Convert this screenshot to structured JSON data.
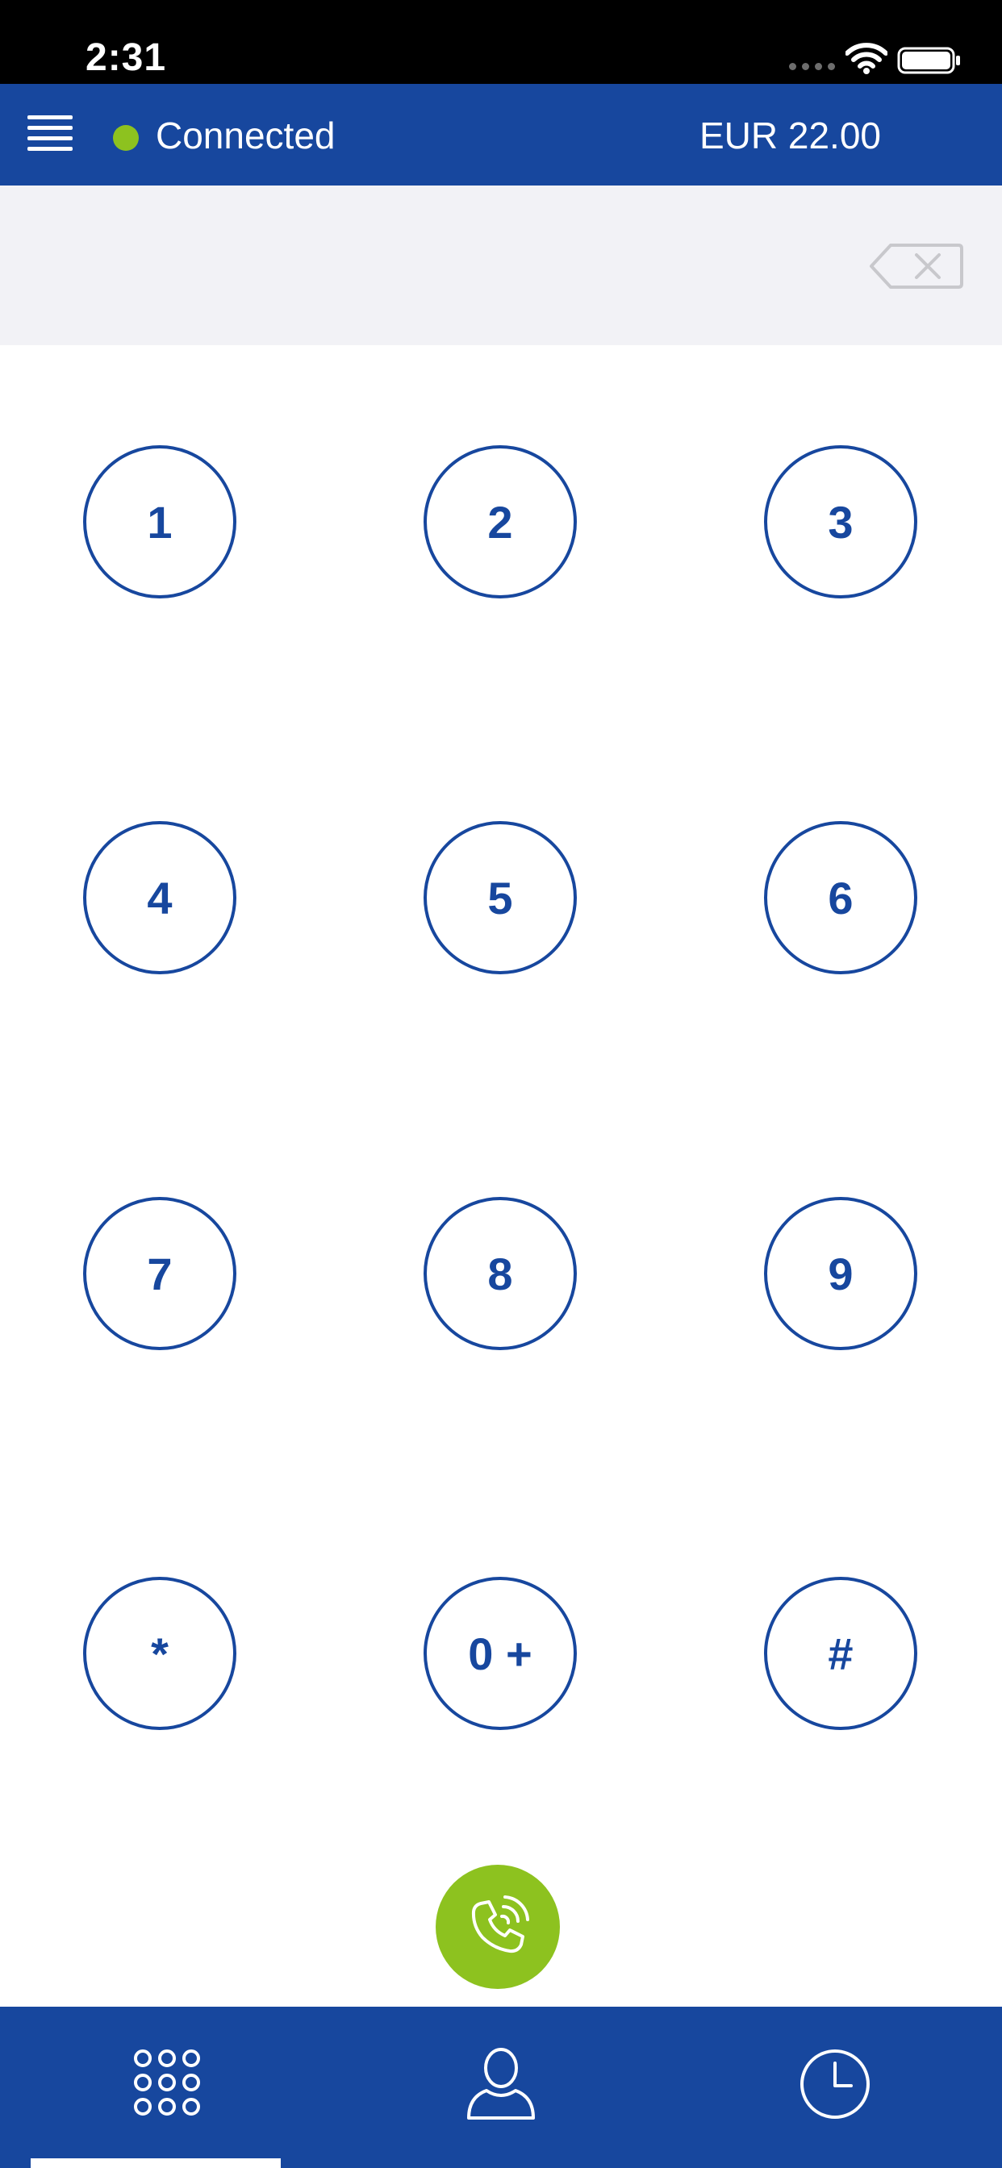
{
  "status_bar": {
    "time": "2:31",
    "wifi_icon": "wifi-icon",
    "battery_icon": "battery-icon"
  },
  "header": {
    "menu_icon": "menu-icon",
    "connection_status": "Connected",
    "connection_color": "#8dc21f",
    "balance": "EUR 22.00",
    "background": "#17479e"
  },
  "display": {
    "dialed_number": "",
    "backspace_icon": "backspace-icon"
  },
  "keypad": {
    "keys": [
      "1",
      "2",
      "3",
      "4",
      "5",
      "6",
      "7",
      "8",
      "9",
      "*",
      "0 +",
      "#"
    ]
  },
  "call_button": {
    "icon": "phone-call-icon",
    "color": "#8dc21f"
  },
  "tabs": [
    {
      "name": "keypad",
      "icon": "dialpad-icon",
      "active": true
    },
    {
      "name": "contacts",
      "icon": "person-icon",
      "active": false
    },
    {
      "name": "history",
      "icon": "clock-icon",
      "active": false
    }
  ],
  "colors": {
    "brand_blue": "#17479e",
    "accent_green": "#8dc21f",
    "display_background": "#f2f2f6"
  }
}
